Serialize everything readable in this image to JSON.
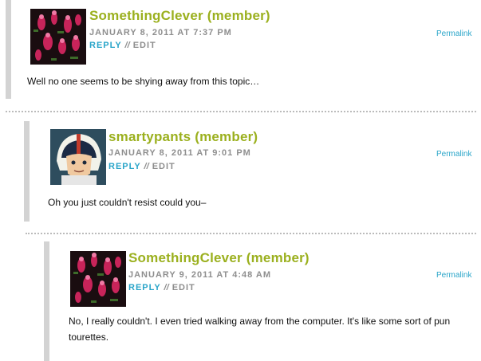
{
  "comments": [
    {
      "author": "SomethingClever (member)",
      "date": "JANUARY 8, 2011 AT 7:37 PM",
      "reply": "REPLY",
      "separator": "//",
      "edit": "EDIT",
      "permalink": "Permalink",
      "text": "Well no one seems to be shying away from this topic…",
      "avatar_icon": "flamingo-avatar-icon"
    },
    {
      "author": "smartypants (member)",
      "date": "JANUARY 8, 2011 AT 9:01 PM",
      "reply": "REPLY",
      "separator": "//",
      "edit": "EDIT",
      "permalink": "Permalink",
      "text": "Oh you just couldn't resist could you–",
      "avatar_icon": "cartoon-racer-avatar-icon"
    },
    {
      "author": "SomethingClever (member)",
      "date": "JANUARY 9, 2011 AT 4:48 AM",
      "reply": "REPLY",
      "separator": "//",
      "edit": "EDIT",
      "permalink": "Permalink",
      "text": "No, I really couldn't. I even tried walking away from the computer. It's like some sort of pun tourettes.",
      "avatar_icon": "flamingo-avatar-icon"
    }
  ],
  "colors": {
    "author": "#9bb01e",
    "link": "#2aa5c9",
    "meta": "#8e8e8e",
    "bar": "#d3d3d3"
  }
}
